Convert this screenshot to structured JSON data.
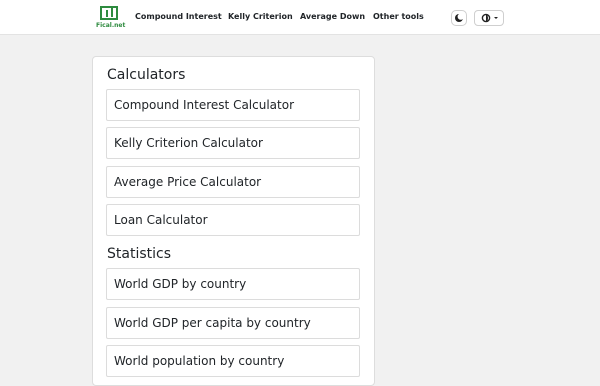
{
  "nav": {
    "logo_text": "Fical.net",
    "links": [
      "Compound Interest",
      "Kelly Criterion",
      "Average Down",
      "Other tools"
    ],
    "theme_icon": "moon-icon",
    "lang_icon": "globe-icon",
    "brand_color": "#2e8b3f"
  },
  "main": {
    "sections": [
      {
        "title": "Calculators",
        "items": [
          "Compound Interest Calculator",
          "Kelly Criterion Calculator",
          "Average Price Calculator",
          "Loan Calculator"
        ]
      },
      {
        "title": "Statistics",
        "items": [
          "World GDP by country",
          "World GDP per capita by country",
          "World population by country"
        ]
      }
    ]
  }
}
